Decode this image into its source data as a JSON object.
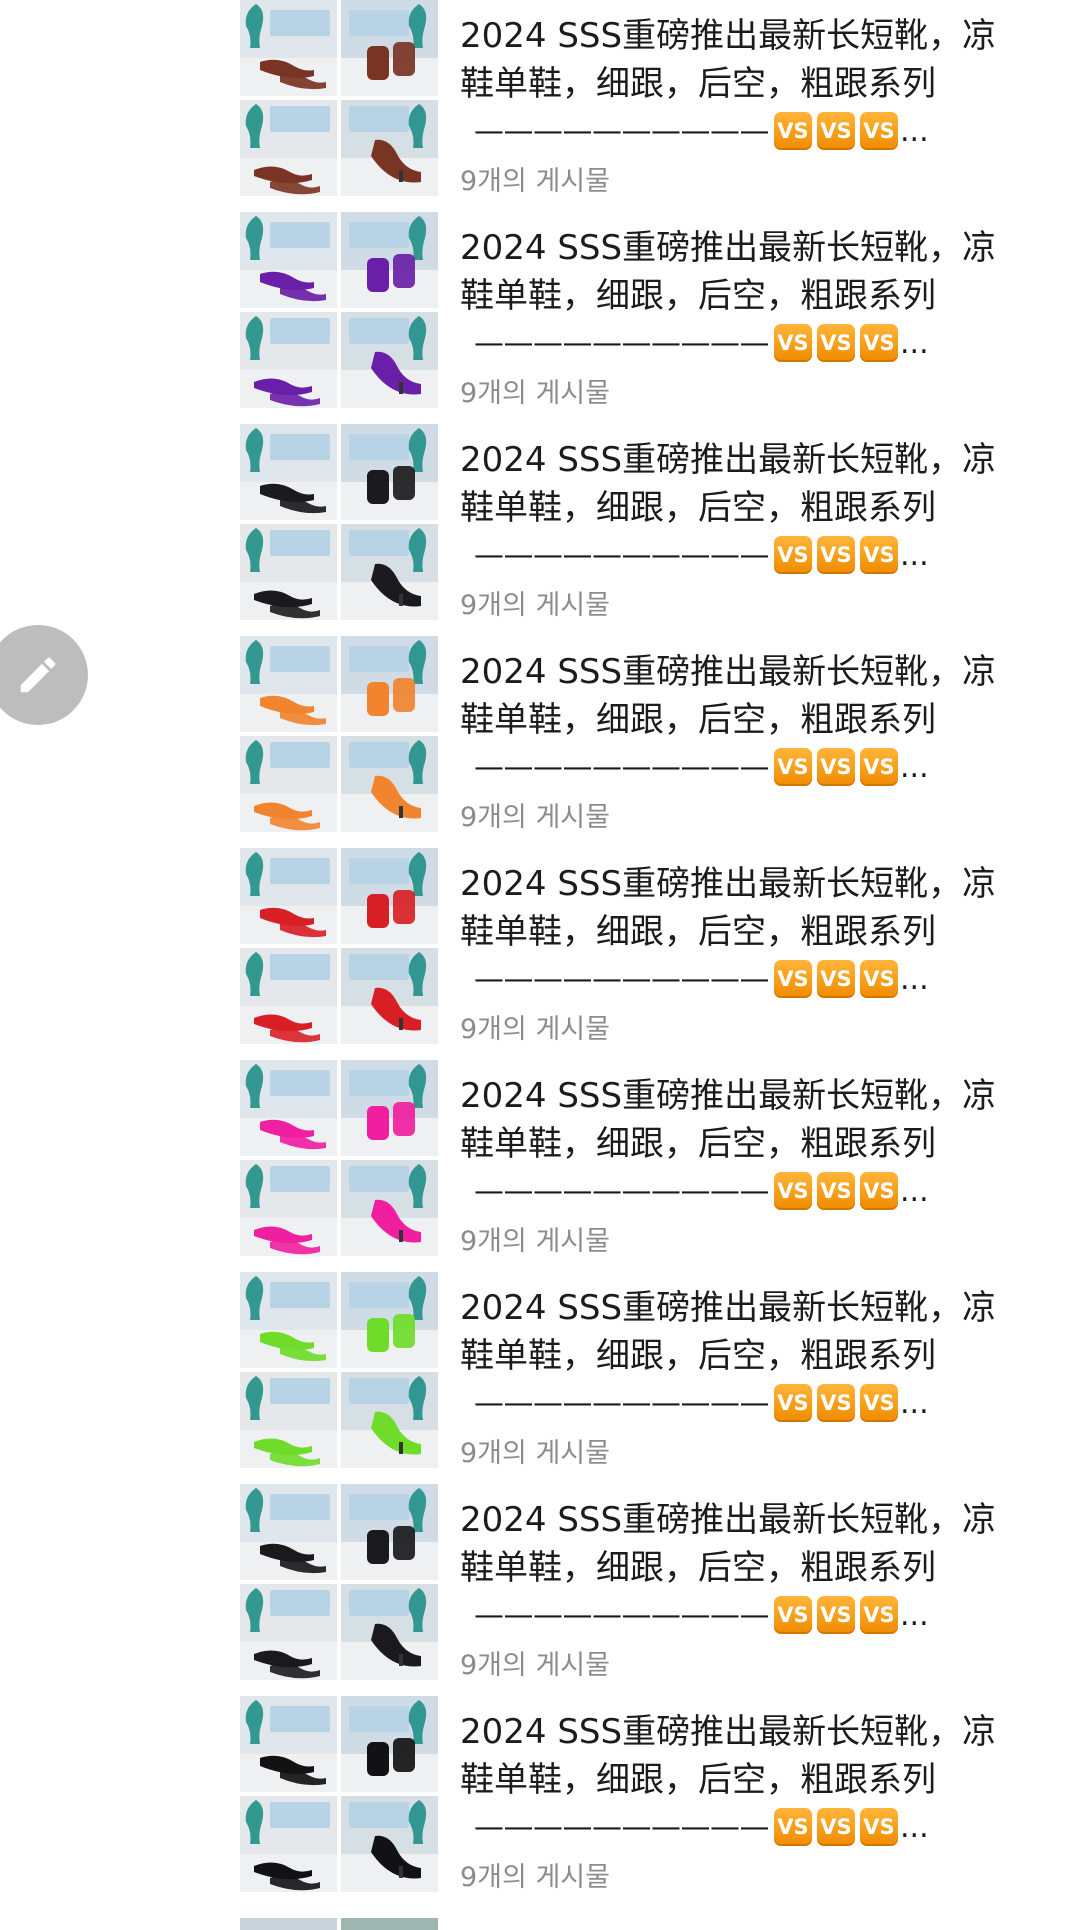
{
  "edit_button": {
    "icon": "pencil-icon"
  },
  "posts": [
    {
      "title_line1": "2024 SSS重磅推出最新长短靴，凉",
      "title_line2": "鞋单鞋，细跟，后空，粗跟系列",
      "dashes": "——————————",
      "badges": [
        "VS",
        "VS",
        "VS"
      ],
      "ellipsis": "...",
      "count": "9개의 게시물",
      "shoe_color": "#7a3424"
    },
    {
      "title_line1": "2024 SSS重磅推出最新长短靴，凉",
      "title_line2": "鞋单鞋，细跟，后空，粗跟系列",
      "dashes": "——————————",
      "badges": [
        "VS",
        "VS",
        "VS"
      ],
      "ellipsis": "...",
      "count": "9개의 게시물",
      "shoe_color": "#6a1fa8"
    },
    {
      "title_line1": "2024 SSS重磅推出最新长短靴，凉",
      "title_line2": "鞋单鞋，细跟，后空，粗跟系列",
      "dashes": "——————————",
      "badges": [
        "VS",
        "VS",
        "VS"
      ],
      "ellipsis": "...",
      "count": "9개의 게시물",
      "shoe_color": "#1b1b1d"
    },
    {
      "title_line1": "2024 SSS重磅推出最新长短靴，凉",
      "title_line2": "鞋单鞋，细跟，后空，粗跟系列",
      "dashes": "——————————",
      "badges": [
        "VS",
        "VS",
        "VS"
      ],
      "ellipsis": "...",
      "count": "9개의 게시물",
      "shoe_color": "#f2832f"
    },
    {
      "title_line1": "2024 SSS重磅推出最新长短靴，凉",
      "title_line2": "鞋单鞋，细跟，后空，粗跟系列",
      "dashes": "——————————",
      "badges": [
        "VS",
        "VS",
        "VS"
      ],
      "ellipsis": "...",
      "count": "9개의 게시물",
      "shoe_color": "#d81f26"
    },
    {
      "title_line1": "2024 SSS重磅推出最新长短靴，凉",
      "title_line2": "鞋单鞋，细跟，后空，粗跟系列",
      "dashes": "——————————",
      "badges": [
        "VS",
        "VS",
        "VS"
      ],
      "ellipsis": "...",
      "count": "9개의 게시물",
      "shoe_color": "#f01fa0"
    },
    {
      "title_line1": "2024 SSS重磅推出最新长短靴，凉",
      "title_line2": "鞋单鞋，细跟，后空，粗跟系列",
      "dashes": "——————————",
      "badges": [
        "VS",
        "VS",
        "VS"
      ],
      "ellipsis": "...",
      "count": "9개의 게시물",
      "shoe_color": "#6fdc2a"
    },
    {
      "title_line1": "2024 SSS重磅推出最新长短靴，凉",
      "title_line2": "鞋单鞋，细跟，后空，粗跟系列",
      "dashes": "——————————",
      "badges": [
        "VS",
        "VS",
        "VS"
      ],
      "ellipsis": "...",
      "count": "9개의 게시물",
      "shoe_color": "#1a1a1c"
    },
    {
      "title_line1": "2024 SSS重磅推出最新长短靴，凉",
      "title_line2": "鞋单鞋，细跟，后空，粗跟系列",
      "dashes": "——————————",
      "badges": [
        "VS",
        "VS",
        "VS"
      ],
      "ellipsis": "...",
      "count": "9개의 게시물",
      "shoe_color": "#121214"
    }
  ]
}
